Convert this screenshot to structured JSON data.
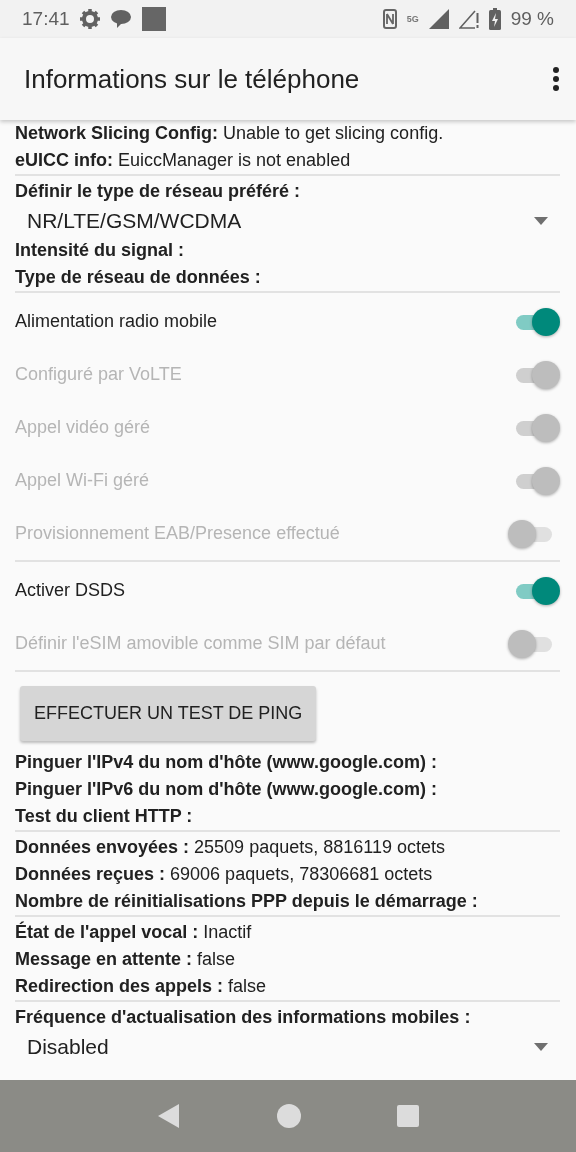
{
  "status_bar": {
    "time": "17:41",
    "network": "5G",
    "battery": "99 %"
  },
  "app_bar": {
    "title": "Informations sur le téléphone"
  },
  "sections": [
    {
      "kind": "info",
      "label": "Network Slicing Config:",
      "value": "Unable to get slicing config."
    },
    {
      "kind": "info",
      "label": "eUICC info:",
      "value": "EuiccManager is not enabled"
    },
    {
      "kind": "divider"
    },
    {
      "kind": "info",
      "label": "Définir le type de réseau préféré :"
    },
    {
      "kind": "spinner",
      "value": "NR/LTE/GSM/WCDMA"
    },
    {
      "kind": "info",
      "label": "Intensité du signal :"
    },
    {
      "kind": "info",
      "label": "Type de réseau de données :"
    },
    {
      "kind": "divider"
    },
    {
      "kind": "switch",
      "label": "Alimentation radio mobile",
      "on": true,
      "disabled": false
    },
    {
      "kind": "switch",
      "label": "Configuré par VoLTE",
      "on": true,
      "disabled": true
    },
    {
      "kind": "switch",
      "label": "Appel vidéo géré",
      "on": true,
      "disabled": true
    },
    {
      "kind": "switch",
      "label": "Appel Wi-Fi géré",
      "on": true,
      "disabled": true
    },
    {
      "kind": "switch",
      "label": "Provisionnement EAB/Presence effectué",
      "on": false,
      "disabled": true
    },
    {
      "kind": "divider"
    },
    {
      "kind": "switch",
      "label": "Activer DSDS",
      "on": true,
      "disabled": false
    },
    {
      "kind": "switch",
      "label": "Définir l'eSIM amovible comme SIM par défaut",
      "on": false,
      "disabled": true
    },
    {
      "kind": "divider"
    },
    {
      "kind": "button",
      "label": "EFFECTUER UN TEST DE PING"
    },
    {
      "kind": "info",
      "label": "Pinguer l'IPv4 du nom d'hôte (www.google.com) :"
    },
    {
      "kind": "info",
      "label": "Pinguer l'IPv6 du nom d'hôte (www.google.com) :"
    },
    {
      "kind": "info",
      "label": "Test du client HTTP :"
    },
    {
      "kind": "divider"
    },
    {
      "kind": "info",
      "label": "Données envoyées :",
      "value": "25509 paquets, 8816119 octets"
    },
    {
      "kind": "info",
      "label": "Données reçues :",
      "value": "69006 paquets, 78306681 octets"
    },
    {
      "kind": "info",
      "label": "Nombre de réinitialisations PPP depuis le démarrage :"
    },
    {
      "kind": "divider"
    },
    {
      "kind": "info",
      "label": "État de l'appel vocal :",
      "value": "Inactif"
    },
    {
      "kind": "info",
      "label": "Message en attente :",
      "value": "false"
    },
    {
      "kind": "info",
      "label": "Redirection des appels :",
      "value": "false"
    },
    {
      "kind": "divider"
    },
    {
      "kind": "info",
      "label": "Fréquence d'actualisation des informations mobiles :"
    },
    {
      "kind": "spinner",
      "value": "Disabled"
    }
  ]
}
